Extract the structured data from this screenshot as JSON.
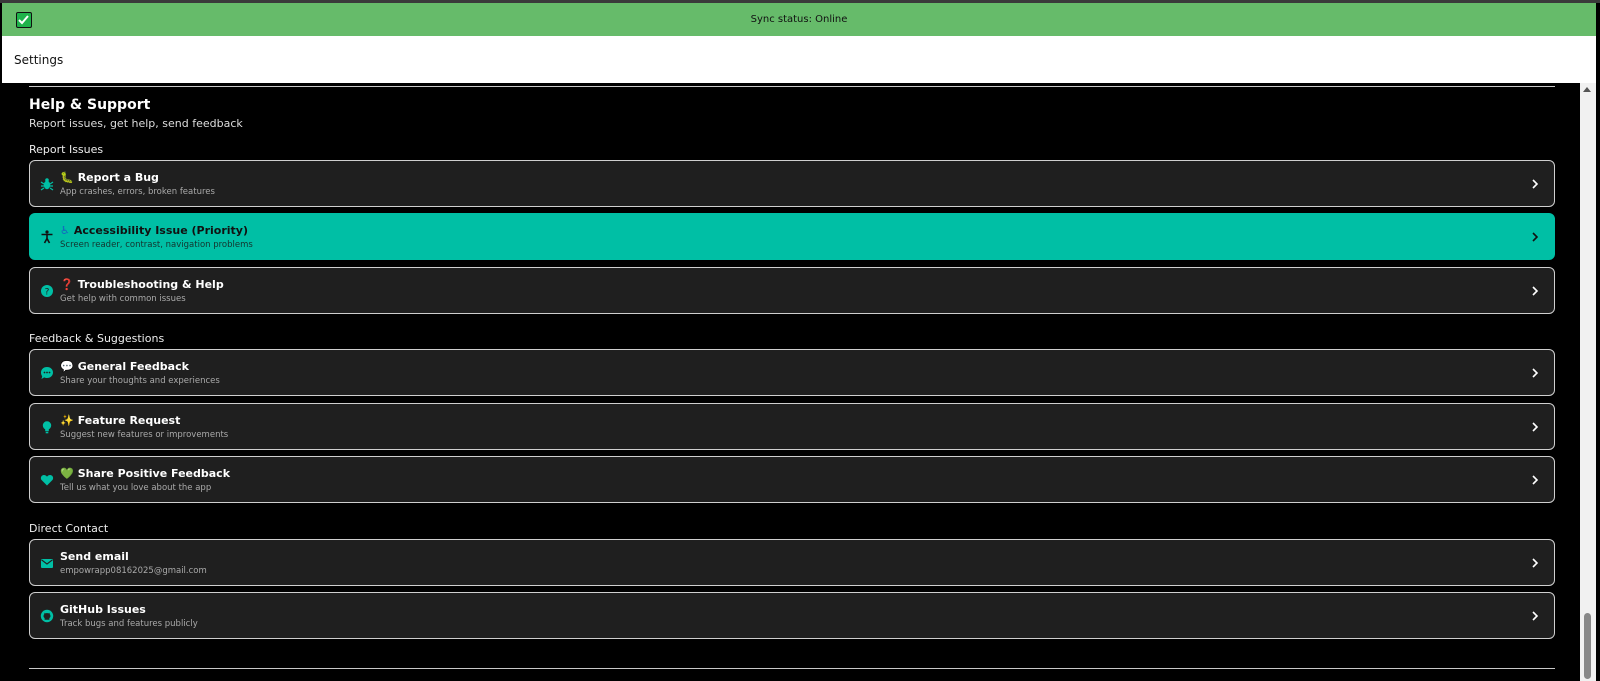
{
  "colors": {
    "accent": "#00bfa5",
    "sync_bar": "#66bb6a",
    "card_bg": "#1f1f1f",
    "page_bg": "#000000"
  },
  "sync": {
    "status_text": "Sync status: Online",
    "icon": "checkbox-checked-icon"
  },
  "header": {
    "title": "Settings"
  },
  "section": {
    "title": "Help & Support",
    "subtitle": "Report issues, get help, send feedback"
  },
  "groups": {
    "report": {
      "label": "Report Issues",
      "items": [
        {
          "icon": "bug-icon",
          "emoji": "🐛",
          "title": "Report a Bug",
          "subtitle": "App crashes, errors, broken features",
          "active": false
        },
        {
          "icon": "accessibility-icon",
          "emoji": "♿",
          "title": "Accessibility Issue (Priority)",
          "subtitle": "Screen reader, contrast, navigation problems",
          "active": true
        },
        {
          "icon": "help-circle-icon",
          "emoji": "❓",
          "title": "Troubleshooting & Help",
          "subtitle": "Get help with common issues",
          "active": false
        }
      ]
    },
    "feedback": {
      "label": "Feedback & Suggestions",
      "items": [
        {
          "icon": "chat-bubble-icon",
          "emoji": "💬",
          "title": "General Feedback",
          "subtitle": "Share your thoughts and experiences",
          "active": false
        },
        {
          "icon": "lightbulb-icon",
          "emoji": "✨",
          "title": "Feature Request",
          "subtitle": "Suggest new features or improvements",
          "active": false
        },
        {
          "icon": "heart-icon",
          "emoji": "💚",
          "title": "Share Positive Feedback",
          "subtitle": "Tell us what you love about the app",
          "active": false
        }
      ]
    },
    "contact": {
      "label": "Direct Contact",
      "items": [
        {
          "icon": "email-icon",
          "emoji": "",
          "title": "Send email",
          "subtitle": "empowrapp08162025@gmail.com",
          "active": false
        },
        {
          "icon": "github-icon",
          "emoji": "",
          "title": "GitHub Issues",
          "subtitle": "Track bugs and features publicly",
          "active": false
        }
      ]
    }
  }
}
